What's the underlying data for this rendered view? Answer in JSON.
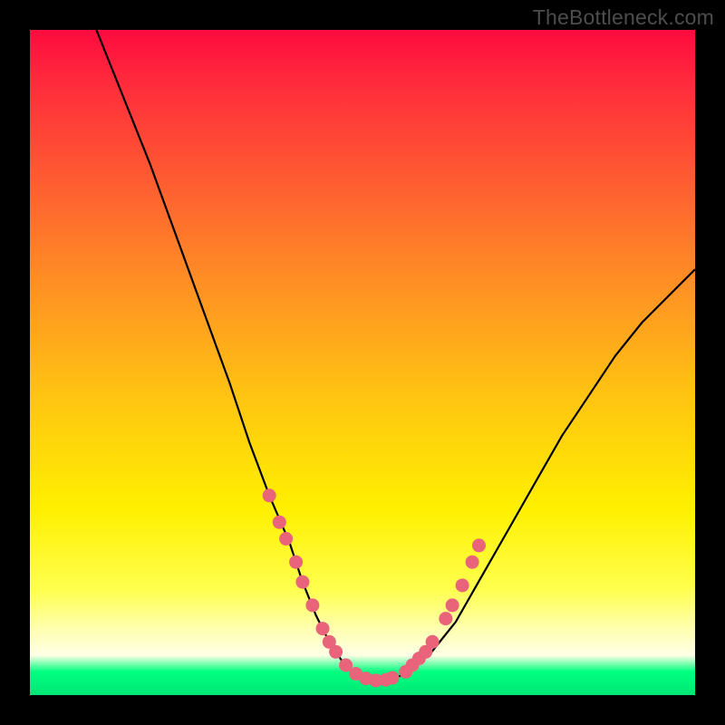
{
  "watermark": "TheBottleneck.com",
  "chart_data": {
    "type": "line",
    "title": "",
    "xlabel": "",
    "ylabel": "",
    "xlim": [
      0,
      100
    ],
    "ylim": [
      0,
      100
    ],
    "series": [
      {
        "name": "curve",
        "x": [
          10,
          14,
          18,
          22,
          26,
          30,
          33,
          36,
          39,
          41,
          43,
          45,
          47,
          49,
          51,
          53,
          56,
          60,
          64,
          68,
          72,
          76,
          80,
          84,
          88,
          92,
          96,
          100
        ],
        "y": [
          100,
          90,
          80,
          69,
          58,
          47,
          38,
          30,
          23,
          17,
          12,
          8,
          5,
          3,
          2,
          2,
          3,
          6,
          11,
          18,
          25,
          32,
          39,
          45,
          51,
          56,
          60,
          64
        ]
      }
    ],
    "markers_left": {
      "x": [
        36.0,
        37.5,
        38.5,
        40.0,
        41.0,
        42.5,
        44.0,
        45.0,
        46.0,
        47.5,
        49.0,
        50.5,
        52.0,
        53.5,
        54.5
      ],
      "y": [
        30.0,
        26.0,
        23.5,
        20.0,
        17.0,
        13.5,
        10.0,
        8.0,
        6.5,
        4.5,
        3.2,
        2.5,
        2.2,
        2.3,
        2.6
      ]
    },
    "markers_right": {
      "x": [
        56.5,
        57.5,
        58.5,
        59.5,
        60.5,
        62.5,
        63.5,
        65.0,
        66.5,
        67.5
      ],
      "y": [
        3.5,
        4.5,
        5.5,
        6.5,
        8.0,
        11.5,
        13.5,
        16.5,
        20.0,
        22.5
      ]
    },
    "gradient_stops": [
      {
        "pos": 0.0,
        "color": "#ff0b3f"
      },
      {
        "pos": 0.22,
        "color": "#ff5a32"
      },
      {
        "pos": 0.55,
        "color": "#ffc412"
      },
      {
        "pos": 0.84,
        "color": "#ffff4d"
      },
      {
        "pos": 0.965,
        "color": "#00ff7f"
      },
      {
        "pos": 1.0,
        "color": "#00e676"
      }
    ],
    "marker_color": "#e9637a",
    "curve_color": "#000000"
  }
}
